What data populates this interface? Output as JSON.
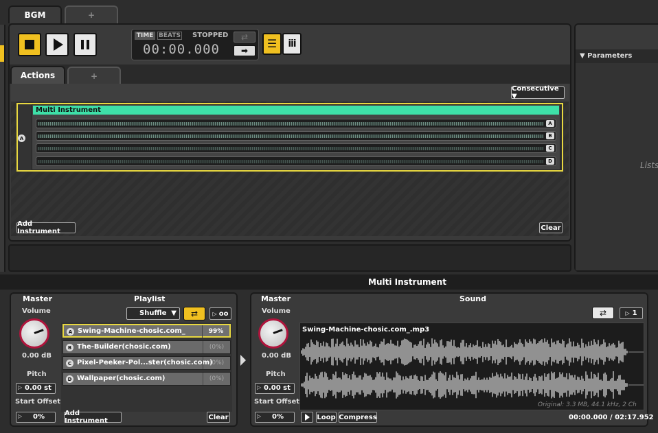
{
  "top_tabs": {
    "active": "BGM",
    "add": "+"
  },
  "transport": {
    "time_label": "TIME",
    "beats_label": "BEATS",
    "status": "STOPPED",
    "time": "00:00.000"
  },
  "action_tabs": {
    "active": "Actions",
    "add": "+"
  },
  "mode_select": "Consecutive ▼",
  "instrument": {
    "row_label": "A",
    "name": "Multi Instrument",
    "tracks": [
      "A",
      "B",
      "C",
      "D"
    ],
    "add_label": "Add Instrument",
    "clear_label": "Clear"
  },
  "parameters": {
    "title": "▼ Parameters",
    "hint": "Lists"
  },
  "section_title": "Multi Instrument",
  "left": {
    "master": "Master",
    "playlist": "Playlist",
    "volume_label": "Volume",
    "volume_value": "0.00 dB",
    "pitch_label": "Pitch",
    "pitch_value": "0.00 st",
    "offset_label": "Start Offset",
    "offset_value": "0%",
    "shuffle": "Shuffle",
    "loop_count": "oo",
    "items": [
      {
        "letter": "A",
        "name": "Swing-Machine-chosic.com_",
        "pct": "99%"
      },
      {
        "letter": "B",
        "name": "The-Builder(chosic.com)",
        "pct": "(0%)"
      },
      {
        "letter": "C",
        "name": "Pixel-Peeker-Pol...ster(chosic.com)",
        "pct": "(0%)"
      },
      {
        "letter": "D",
        "name": "Wallpaper(chosic.com)",
        "pct": "(0%)"
      }
    ],
    "add_label": "Add Instrument",
    "clear_label": "Clear"
  },
  "right": {
    "master": "Master",
    "sound": "Sound",
    "volume_label": "Volume",
    "volume_value": "0.00 dB",
    "pitch_label": "Pitch",
    "pitch_value": "0.00 st",
    "offset_label": "Start Offset",
    "offset_value": "0%",
    "repeat_count": "1",
    "file_name": "Swing-Machine-chosic.com_.mp3",
    "file_info": "Original: 3.3 MB, 44.1 kHz, 2 Ch",
    "loop_label": "Loop",
    "compress_label": "Compress",
    "position": "00:00.000 / 02:17.952"
  },
  "colors": {
    "accent": "#f0c020",
    "instrument_header": "#3ee0a8",
    "knob_ring": "#b0143c"
  }
}
